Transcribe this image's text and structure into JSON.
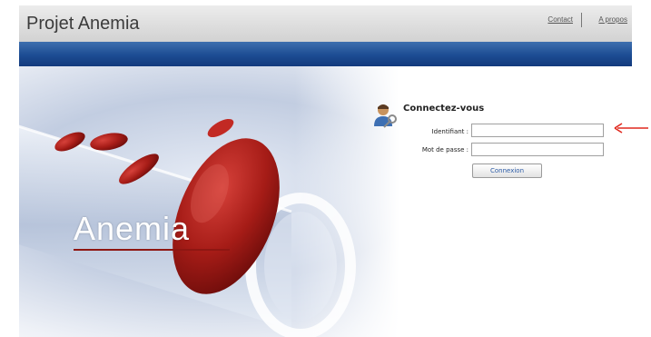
{
  "header": {
    "title": "Projet Anemia",
    "links": {
      "contact": "Contact",
      "about": "A propos"
    }
  },
  "hero": {
    "caption": "Anemia"
  },
  "login": {
    "title": "Connectez-vous",
    "username_label": "Identifiant :",
    "username_value": "",
    "password_label": "Mot de passe :",
    "password_value": "",
    "submit_label": "Connexion"
  },
  "annotation": {
    "arrow_color": "#e0281e",
    "arrow_icon": "left-arrow-icon"
  },
  "colors": {
    "nav_bar": "#1c4c93",
    "cell_red": "#8e1612",
    "button_text": "#2b5aa5"
  }
}
